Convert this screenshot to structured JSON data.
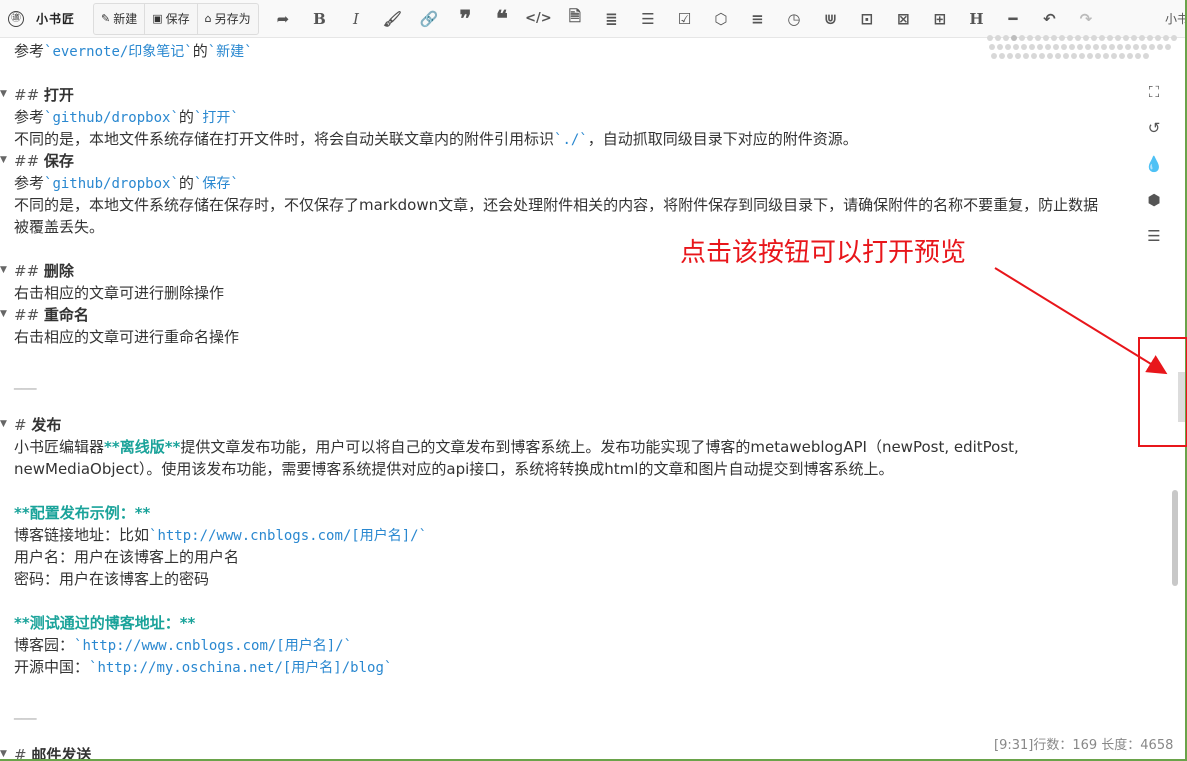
{
  "app": {
    "brand_mark": "㊜",
    "brand_name": "小书匠"
  },
  "toolbar": {
    "new_label": "新建",
    "save_label": "保存",
    "saveas_label": "另存为",
    "user_truncated": "小书"
  },
  "editor": {
    "l1_a": "参考",
    "l1_b": "`evernote/印象笔记`",
    "l1_c": "的",
    "l1_d": "`新建`",
    "h_open": "打开",
    "l3_a": "参考",
    "l3_b": "`github/dropbox`",
    "l3_c": "的",
    "l3_d": "`打开`",
    "l4_a": "不同的是，本地文件系统存储在打开文件时，将会自动关联文章内的附件引用标识",
    "l4_b": "`./`",
    "l4_c": "，自动抓取同级目录下对应的附件资源。",
    "h_save": "保存",
    "l6_a": "参考",
    "l6_b": "`github/dropbox`",
    "l6_c": "的",
    "l6_d": "`保存`",
    "l7": "不同的是，本地文件系统存储在保存时，不仅保存了markdown文章，还会处理附件相关的内容，将附件保存到同级目录下，请确保附件的名称不要重复，防止数据",
    "l8": "被覆盖丢失。",
    "h_delete": "删除",
    "l10": "右击相应的文章可进行删除操作",
    "h_rename": "重命名",
    "l12": "右击相应的文章可进行重命名操作",
    "hr": "___",
    "h_publish": "发布",
    "l15_a": "小书匠编辑器",
    "l15_b": "**离线版**",
    "l15_c": "提供文章发布功能，用户可以将自己的文章发布到博客系统上。发布功能实现了博客的metaweblogAPI（newPost, editPost,",
    "l16": "newMediaObject）。使用该发布功能，需要博客系统提供对应的api接口，系统将转换成html的文章和图片自动提交到博客系统上。",
    "l17": "**配置发布示例：**",
    "l18_a": "博客链接地址：比如",
    "l18_b": "`http://www.cnblogs.com/[用户名]/`",
    "l19": "用户名：用户在该博客上的用户名",
    "l20": "密码：用户在该博客上的密码",
    "l21": "**测试通过的博客地址：**",
    "l22_a": "博客园：",
    "l22_b": "`http://www.cnblogs.com/[用户名]/`",
    "l23_a": "开源中国：",
    "l23_b": "`http://my.oschina.net/[用户名]/blog`",
    "h_mail": "邮件发送",
    "h2_mark": "##",
    "h1_mark": "#"
  },
  "annotation": {
    "text": "点击该按钮可以打开预览",
    "color": "#e8161b"
  },
  "status": {
    "text": "[9:31]行数：169 长度：4658"
  },
  "icons": [
    "bold-icon",
    "italic-icon",
    "link-icon",
    "quote-icon",
    "code-icon",
    "list-icon",
    "table-icon",
    "undo-icon",
    "redo-icon"
  ]
}
